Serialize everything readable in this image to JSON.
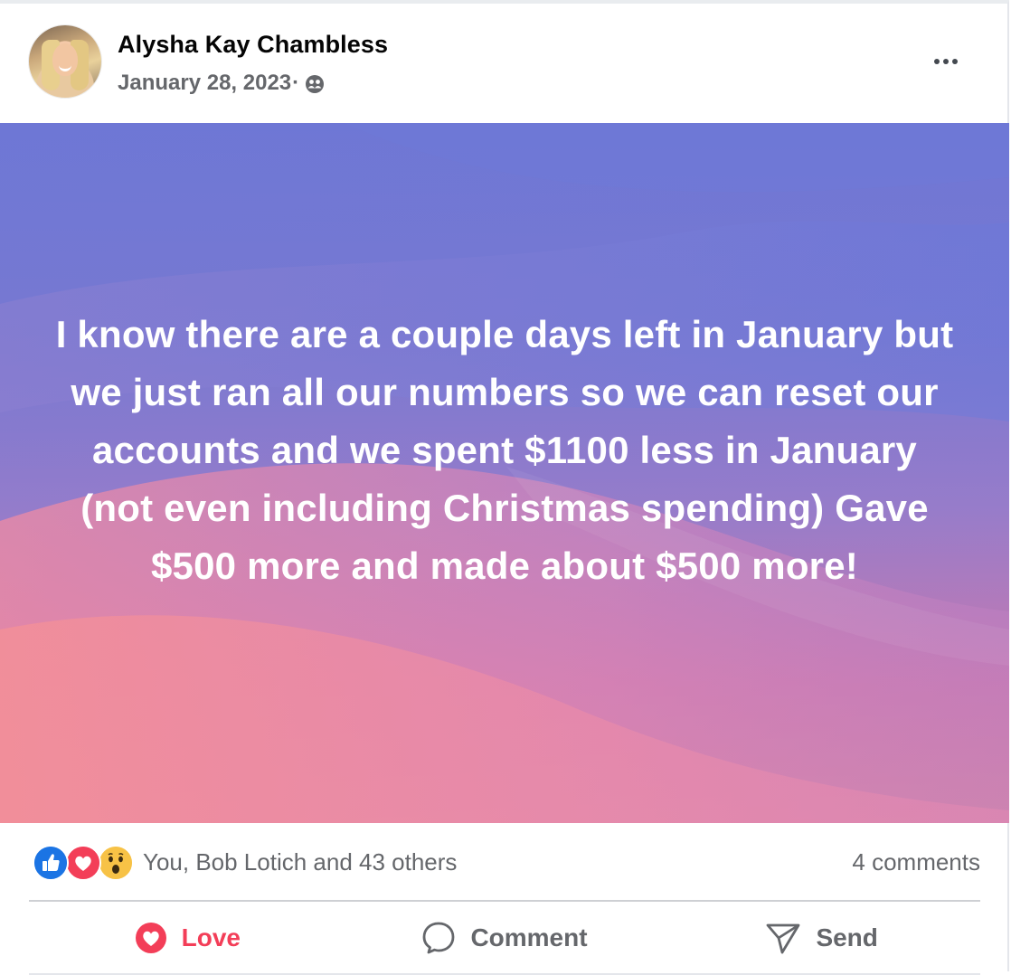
{
  "post": {
    "author_name": "Alysha Kay Chambless",
    "date": "January 28, 2023",
    "separator": "·",
    "privacy_icon": "friends-icon",
    "more_icon": "more-horizontal-icon",
    "body_text": "I know there are a couple days left in January but we just ran all our numbers so we can reset our accounts and we spent $1100 less in January (not even including Christmas spending) Gave $500 more and made about $500 more!",
    "background_colors": [
      "#6f76d4",
      "#a37dc6",
      "#f08a96"
    ]
  },
  "reactions": {
    "icons": [
      "like-icon",
      "love-icon",
      "wow-icon"
    ],
    "summary": "You, Bob Lotich and 43 others",
    "comments": "4 comments"
  },
  "actions": [
    {
      "label": "Love",
      "icon": "heart-icon",
      "color": "#f33e58"
    },
    {
      "label": "Comment",
      "icon": "comment-bubble-icon"
    },
    {
      "label": "Send",
      "icon": "send-icon"
    }
  ]
}
